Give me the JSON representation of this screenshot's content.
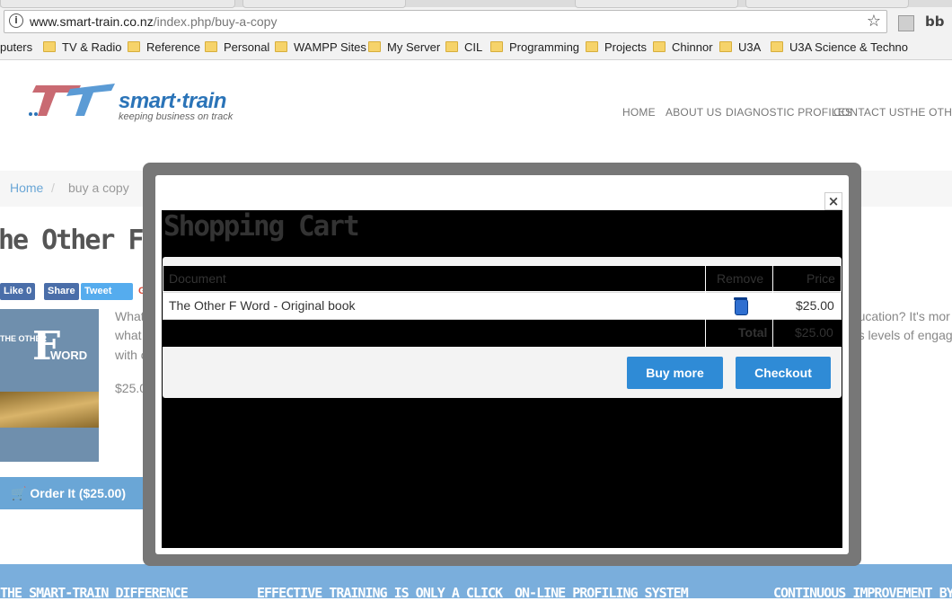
{
  "browser": {
    "url_domain": "www.smart-train.co.nz",
    "url_path": "/index.php/buy-a-copy",
    "bookmarks": [
      "puters",
      "TV & Radio",
      "Reference",
      "Personal",
      "WAMPP Sites",
      "My Server",
      "CIL",
      "Programming",
      "Projects",
      "Chinnor",
      "U3A",
      "U3A Science & Techno"
    ],
    "ext_label": "bb"
  },
  "site": {
    "brand": "smart·train",
    "tagline": "keeping business on track",
    "nav": [
      "HOME",
      "ABOUT US",
      "DIAGNOSTIC PROFILES",
      "CONTACT US",
      "THE OTHER F"
    ],
    "breadcrumb_home": "Home",
    "breadcrumb_sep": "/",
    "breadcrumb_current": "buy a copy",
    "page_title": "he Other F Wo",
    "social": {
      "like": "Like 0",
      "share": "Share",
      "tweet": "Tweet",
      "g": "G"
    },
    "book": {
      "the_other": "THE OTHER",
      "f": "F",
      "word": "WORD"
    },
    "body_lines": [
      "What r",
      "what s",
      "with ot"
    ],
    "body_right": [
      "education? It's mor",
      "ous levels of engag"
    ],
    "price": "$25.00",
    "order_button": "🛒 Order It ($25.00)",
    "footer": [
      "THE SMART-TRAIN DIFFERENCE",
      "EFFECTIVE TRAINING IS ONLY A CLICK",
      "ON-LINE PROFILING SYSTEM",
      "CONTINUOUS IMPROVEMENT BY"
    ]
  },
  "modal": {
    "title": "Shopping Cart",
    "close": "×",
    "columns": {
      "document": "Document",
      "remove": "Remove",
      "price": "Price"
    },
    "items": [
      {
        "document": "The Other F Word - Original book",
        "price": "$25.00"
      }
    ],
    "total_label": "Total",
    "total_value": "$25.00",
    "buy_more": "Buy more",
    "checkout": "Checkout"
  }
}
